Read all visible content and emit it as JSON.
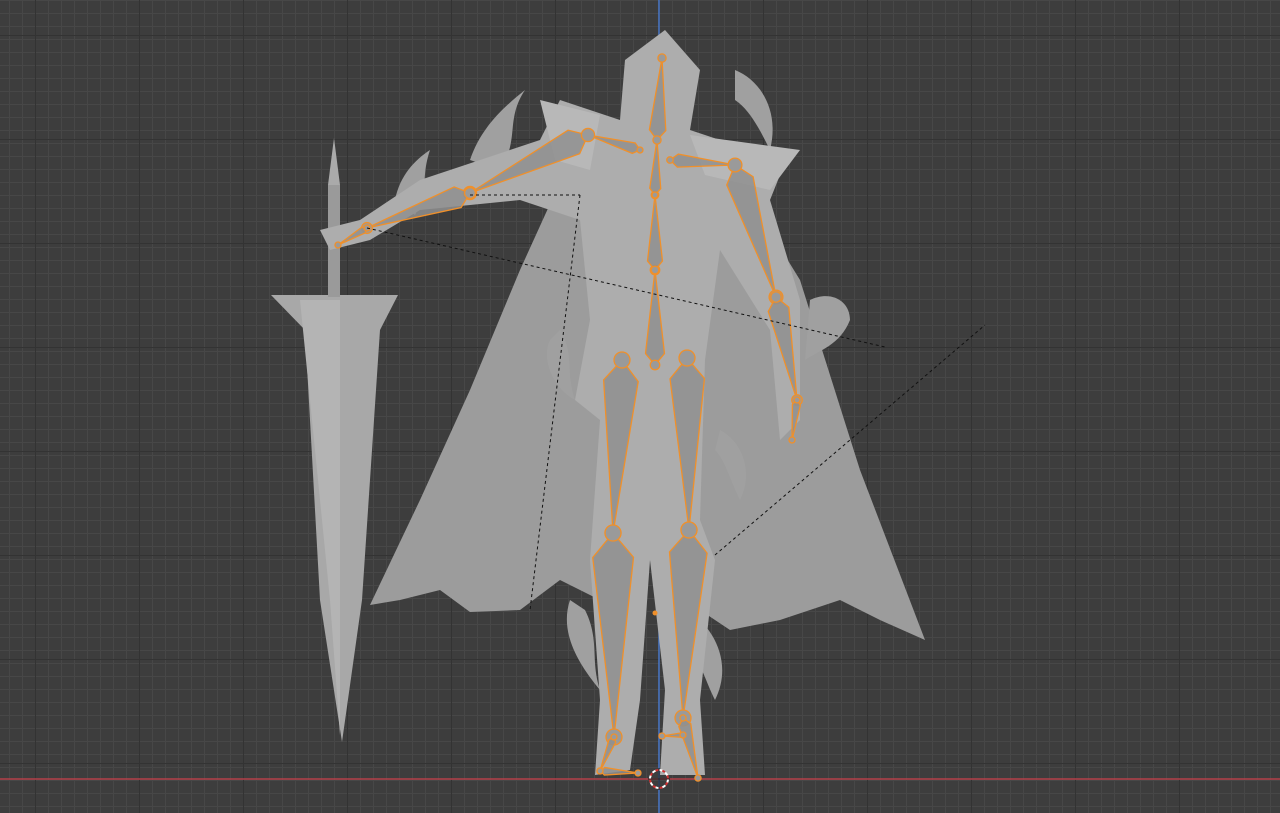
{
  "viewport": {
    "background_color": "#3d3d3d",
    "x_axis_color": "#b5404a",
    "z_axis_color": "#4a78c8",
    "mesh_color": "#a6a6a6",
    "armature_color": "#f0902a"
  }
}
